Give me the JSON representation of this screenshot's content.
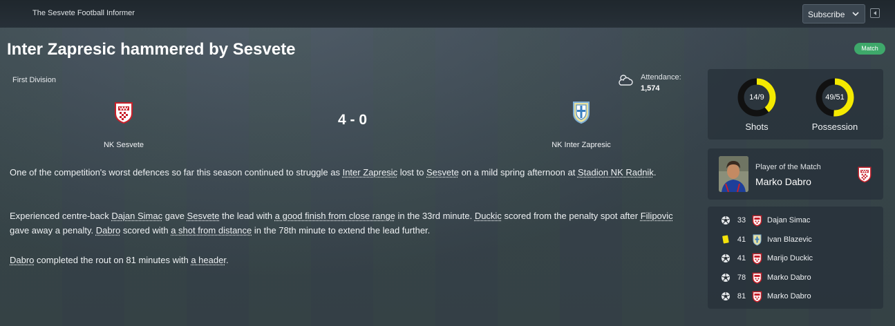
{
  "header": {
    "publisher": "The Sesvete Football Informer",
    "subscribe_label": "Subscribe"
  },
  "article": {
    "headline": "Inter Zapresic hammered by Sesvete",
    "tag": "Match"
  },
  "match": {
    "competition": "First Division",
    "attendance_label": "Attendance:",
    "attendance_value": "1,574",
    "weather_icon": "cloud-icon",
    "home_team": "NK Sesvete",
    "away_team": "NK Inter Zapresic",
    "score": "4 - 0"
  },
  "report": {
    "p1": [
      "One of the competition's worst defences so far this season continued to struggle as ",
      "Inter Zapresic",
      " lost to ",
      "Sesvete",
      " on a mild spring afternoon at ",
      "Stadion NK Radnik",
      "."
    ],
    "p2": [
      "Experienced centre-back ",
      "Dajan Simac",
      " gave ",
      "Sesvete",
      " the lead with ",
      "a good finish from close range",
      " in the 33rd minute. ",
      "Duckic",
      " scored from the penalty spot after ",
      "Filipovic",
      " gave away a penalty. ",
      "Dabro",
      " scored with ",
      "a shot from distance",
      " in the 78th minute to extend the lead further."
    ],
    "p3": [
      "Dabro",
      " completed the rout on 81 minutes with ",
      "a header",
      "."
    ]
  },
  "stats": {
    "shots": {
      "label": "14/9",
      "home": 14,
      "away": 9,
      "caption": "Shots"
    },
    "possession": {
      "label": "49/51",
      "home": 49,
      "away": 51,
      "caption": "Possession"
    }
  },
  "player_of_match": {
    "label": "Player of the Match",
    "name": "Marko Dabro"
  },
  "events": [
    {
      "icon": "football-icon",
      "minute": "33",
      "team": "home",
      "player": "Dajan Simac"
    },
    {
      "icon": "yellow-card-icon",
      "minute": "41",
      "team": "away",
      "player": "Ivan Blazevic"
    },
    {
      "icon": "football-icon",
      "minute": "41",
      "team": "home",
      "player": "Marijo Duckic"
    },
    {
      "icon": "football-icon",
      "minute": "78",
      "team": "home",
      "player": "Marko Dabro"
    },
    {
      "icon": "football-icon",
      "minute": "81",
      "team": "home",
      "player": "Marko Dabro"
    }
  ],
  "colors": {
    "away_stat": "#f5ea00",
    "home_stat": "#111111",
    "tag": "#3ea86a",
    "home_badge": "#c8202a",
    "away_badge": "#e6e0a0"
  }
}
